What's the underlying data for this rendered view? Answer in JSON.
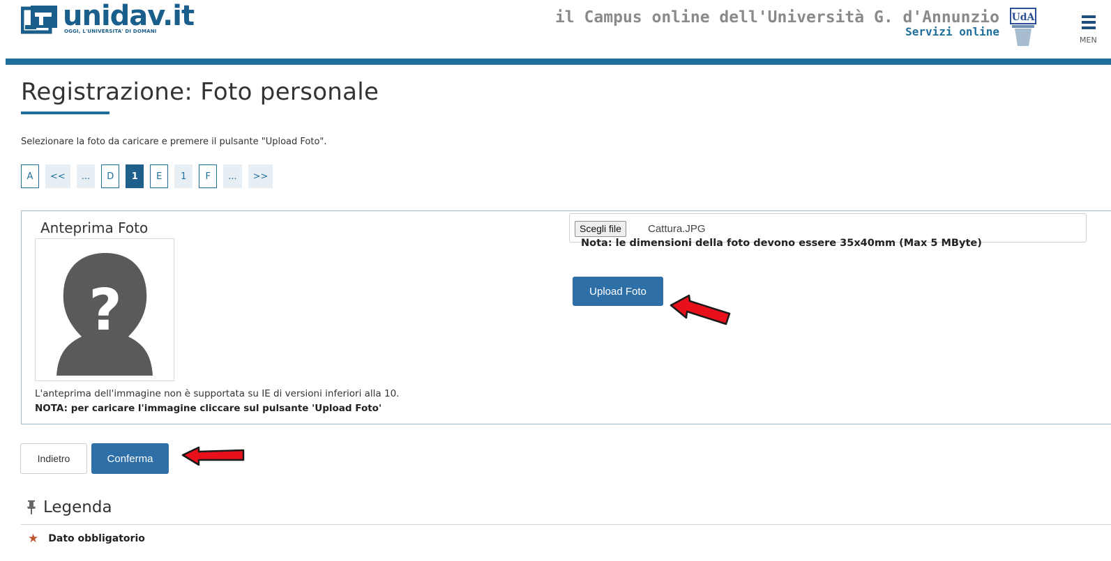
{
  "header": {
    "logo_main": "unidav.it",
    "logo_sub": "OGGI, L'UNIVERSITA' DI DOMANI",
    "campus_title": "il Campus online dell'Università G. d'Annunzio",
    "campus_sub": "Servizi online",
    "uda_logo_text": "UdA",
    "menu_label": "MEN"
  },
  "page": {
    "title": "Registrazione: Foto personale",
    "instructions": "Selezionare la foto da caricare e premere il pulsante \"Upload Foto\"."
  },
  "pager": {
    "items": [
      {
        "label": "A",
        "kind": "letter"
      },
      {
        "label": "<<",
        "kind": "plain"
      },
      {
        "label": "...",
        "kind": "plain"
      },
      {
        "label": "D",
        "kind": "letter"
      },
      {
        "label": "1",
        "kind": "active"
      },
      {
        "label": "E",
        "kind": "letter"
      },
      {
        "label": "1",
        "kind": "plain"
      },
      {
        "label": "F",
        "kind": "letter"
      },
      {
        "label": "...",
        "kind": "plain"
      },
      {
        "label": ">>",
        "kind": "plain"
      }
    ]
  },
  "photo_panel": {
    "preview_title": "Anteprima Foto",
    "note_ie": "L'anteprima dell'immagine non è supportata su IE di versioni inferiori alla 10.",
    "note_upload": "NOTA: per caricare l'immagine cliccare sul pulsante 'Upload Foto'",
    "file_button": "Scegli file",
    "file_name": "Cattura.JPG",
    "size_note": "Nota: le dimensioni della foto devono essere 35x40mm (Max 5 MByte)",
    "upload_button": "Upload Foto"
  },
  "actions": {
    "back": "Indietro",
    "confirm": "Conferma"
  },
  "legend": {
    "title": "Legenda",
    "required_label": "Dato obbligatorio",
    "icons": {
      "header": "pushpin-icon",
      "required": "asterisk-icon"
    }
  },
  "colors": {
    "brand_blue": "#1f6f9c",
    "button_blue": "#2f6fa8",
    "arrow_red": "#e8101a",
    "required_star": "#c0532f"
  }
}
